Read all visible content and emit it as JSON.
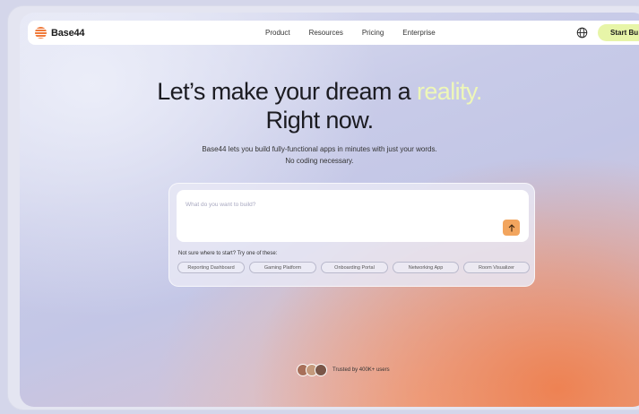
{
  "nav": {
    "brand": "Base44",
    "links": [
      "Product",
      "Resources",
      "Pricing",
      "Enterprise"
    ],
    "cta": "Start Bu"
  },
  "hero": {
    "title_line1_prefix": "Let’s make your dream a ",
    "title_line1_highlight": "reality.",
    "title_line2": "Right now.",
    "subtitle_line1": "Base44 lets you build fully-functional apps in minutes with just your words.",
    "subtitle_line2": "No coding necessary."
  },
  "prompt": {
    "placeholder": "What do you want to build?",
    "hint": "Not sure where to start? Try one of these:",
    "suggestions": [
      "Reporting Dashboard",
      "Gaming Platform",
      "Onboarding Portal",
      "Networking App",
      "Room Visualizer"
    ]
  },
  "trust": {
    "text": "Trusted by 400K+ users"
  },
  "colors": {
    "accent_orange": "#f2a55e",
    "cta_lime": "#e7f5a8",
    "highlight_text": "#eef7b8"
  },
  "icons": {
    "globe": "globe-icon",
    "send": "arrow-up-icon"
  }
}
